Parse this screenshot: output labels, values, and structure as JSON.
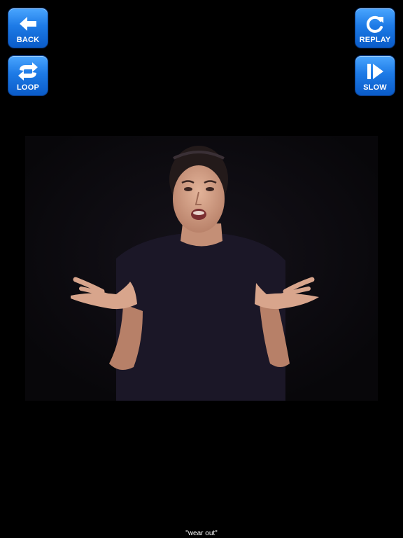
{
  "toolbar": {
    "back": {
      "label": "BACK",
      "icon": "arrow-left-icon"
    },
    "loop": {
      "label": "LOOP",
      "icon": "loop-arrows-icon"
    },
    "replay": {
      "label": "REPLAY",
      "icon": "replay-icon"
    },
    "slow": {
      "label": "SLOW",
      "icon": "slow-play-icon"
    }
  },
  "video": {
    "content": "signer-figure"
  },
  "caption": "\"wear out\"",
  "colors": {
    "background": "#000000",
    "button": "#1d7ae6",
    "video_background": "#0d0b10",
    "caption_text": "#ffffff"
  }
}
